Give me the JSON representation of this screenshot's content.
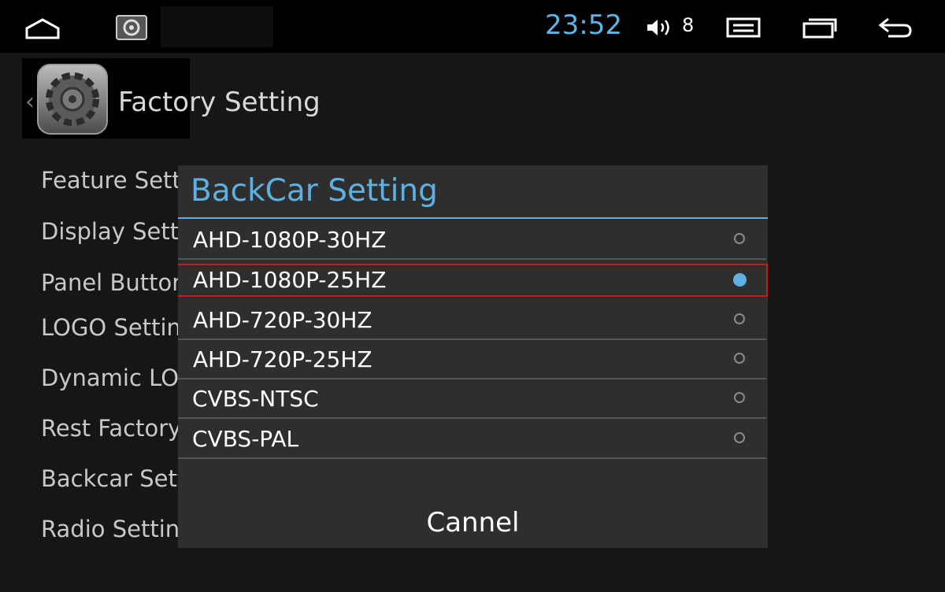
{
  "statusbar": {
    "clock": "23:52",
    "volume_level": "8",
    "icons": [
      "home-icon",
      "app-thumbnail-icon",
      "volume-icon",
      "menu-icon",
      "recents-icon",
      "back-icon"
    ],
    "accent": "#5fb4e6"
  },
  "page": {
    "title": "Factory Setting",
    "back_glyph": "‹",
    "menu_items": [
      "Feature Setting",
      "Display Setting",
      "Panel Button",
      "LOGO Setting",
      "Dynamic LOGO",
      "Rest Factory",
      "Backcar Setting",
      "Radio Setting"
    ]
  },
  "dialog": {
    "title": "BackCar Setting",
    "options": [
      {
        "label": "AHD-1080P-30HZ",
        "selected": false
      },
      {
        "label": "AHD-1080P-25HZ",
        "selected": true
      },
      {
        "label": "AHD-720P-30HZ",
        "selected": false
      },
      {
        "label": "AHD-720P-25HZ",
        "selected": false
      },
      {
        "label": "CVBS-NTSC",
        "selected": false
      },
      {
        "label": "CVBS-PAL",
        "selected": false
      }
    ],
    "cancel_label": "Cannel",
    "accent": "#5eb0e3",
    "highlight_color": "#c81a1a"
  }
}
